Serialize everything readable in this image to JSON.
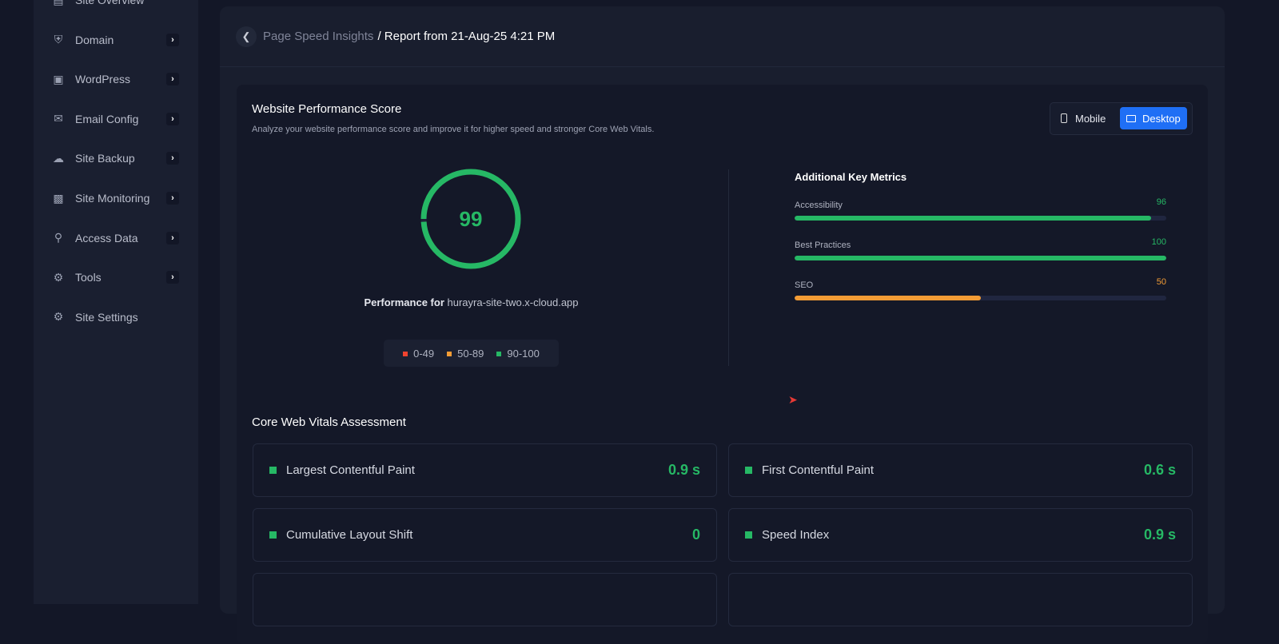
{
  "sidebar": {
    "items": [
      {
        "label": "Site Overview",
        "icon": "overview-icon",
        "chev": false
      },
      {
        "label": "Domain",
        "icon": "shield-icon",
        "chev": true
      },
      {
        "label": "WordPress",
        "icon": "wordpress-icon",
        "chev": true
      },
      {
        "label": "Email Config",
        "icon": "mail-icon",
        "chev": true
      },
      {
        "label": "Site Backup",
        "icon": "backup-icon",
        "chev": true
      },
      {
        "label": "Site Monitoring",
        "icon": "monitor-icon",
        "chev": true
      },
      {
        "label": "Access Data",
        "icon": "key-icon",
        "chev": true
      },
      {
        "label": "Tools",
        "icon": "tools-icon",
        "chev": true
      },
      {
        "label": "Site Settings",
        "icon": "gear-icon",
        "chev": false
      }
    ]
  },
  "header": {
    "crumb_parent": "Page Speed Insights",
    "crumb_current": "/ Report from 21-Aug-25 4:21 PM"
  },
  "score": {
    "title": "Website Performance Score",
    "subtitle": "Analyze your website performance score and improve it for higher speed and stronger Core Web Vitals.",
    "value": "99",
    "value_num": 99,
    "perf_label": "Performance for",
    "site": "hurayra-site-two.x-cloud.app",
    "legend": [
      {
        "label": "0-49",
        "color": "#f0432f"
      },
      {
        "label": "50-89",
        "color": "#f39c35"
      },
      {
        "label": "90-100",
        "color": "#26b865"
      }
    ]
  },
  "toggle": {
    "mobile": "Mobile",
    "desktop": "Desktop",
    "active": "Desktop"
  },
  "metrics": {
    "title": "Additional Key Metrics",
    "items": [
      {
        "label": "Accessibility",
        "value": "96",
        "num": 96,
        "color": "#26b865"
      },
      {
        "label": "Best Practices",
        "value": "100",
        "num": 100,
        "color": "#26b865"
      },
      {
        "label": "SEO",
        "value": "50",
        "num": 50,
        "color": "#f39c35"
      }
    ]
  },
  "vitals": {
    "title": "Core Web Vitals Assessment",
    "items": [
      {
        "label": "Largest Contentful Paint",
        "value": "0.9 s"
      },
      {
        "label": "First Contentful Paint",
        "value": "0.6 s"
      },
      {
        "label": "Cumulative Layout Shift",
        "value": "0"
      },
      {
        "label": "Speed Index",
        "value": "0.9 s"
      }
    ]
  }
}
